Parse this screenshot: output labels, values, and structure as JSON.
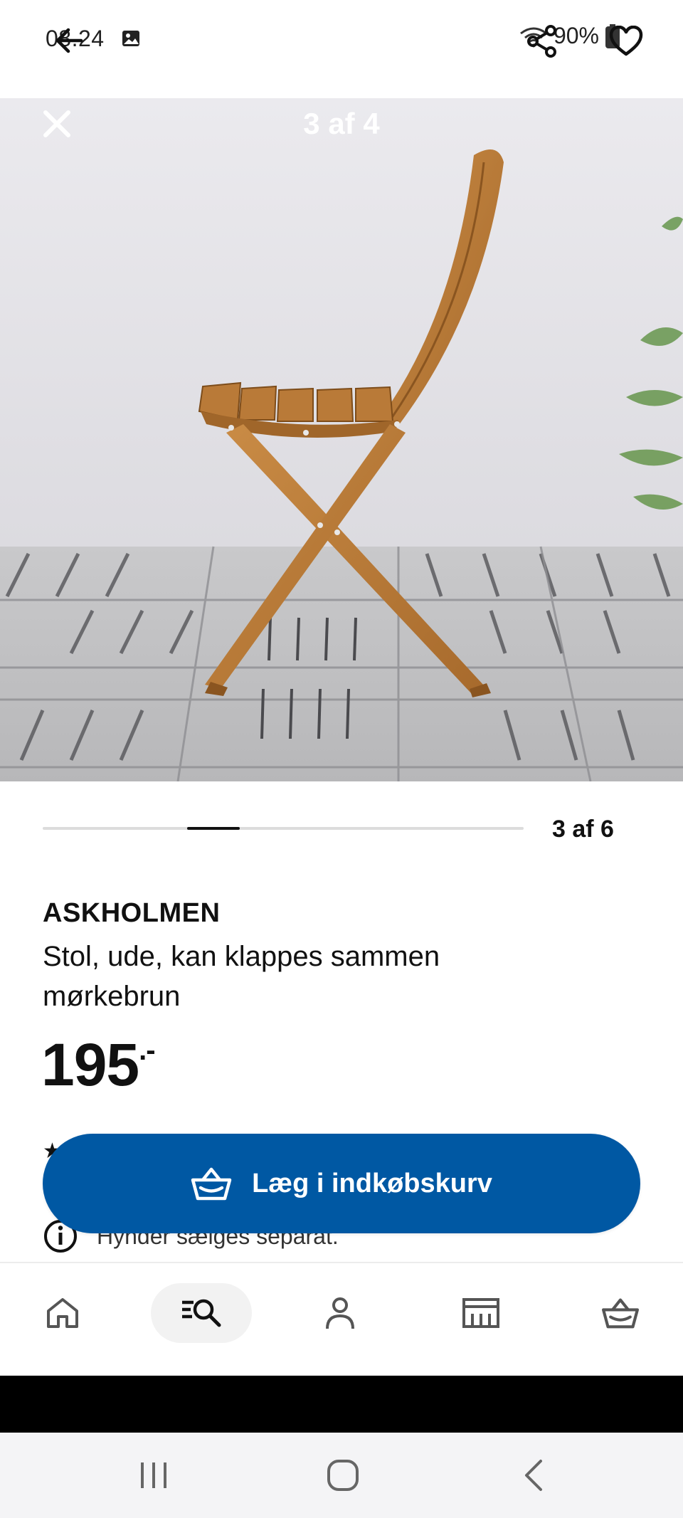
{
  "status_bar": {
    "time": "08.24",
    "battery": "90%",
    "icons": [
      "gallery-icon",
      "wifi-icon",
      "battery-icon"
    ]
  },
  "overlay": {
    "icons": [
      "back-arrow-icon",
      "share-icon",
      "heart-icon"
    ]
  },
  "gallery": {
    "counter": "3 af 4",
    "icons": [
      "close-icon"
    ]
  },
  "carousel": {
    "label": "3 af 6",
    "position": 3,
    "total": 6
  },
  "product": {
    "name": "ASKHOLMEN",
    "description_line1": "Stol, ude, kan klappes sammen",
    "description_line2": "mørkebrun",
    "price": "195",
    "price_suffix": ".-",
    "info_text": "Hynder sælges separat.",
    "rating_peek": "★"
  },
  "cart_button": {
    "label": "Læg i indkøbskurv",
    "icon": "shopping-basket-icon",
    "color": "#0058a3"
  },
  "bottom_nav": {
    "items": [
      {
        "name": "home",
        "icon": "home-icon",
        "active": false
      },
      {
        "name": "search",
        "icon": "search-icon",
        "active": true
      },
      {
        "name": "profile",
        "icon": "person-icon",
        "active": false
      },
      {
        "name": "stores",
        "icon": "store-icon",
        "active": false
      },
      {
        "name": "cart",
        "icon": "basket-icon",
        "active": false
      }
    ]
  },
  "system_nav": {
    "icons": [
      "recent-apps-icon",
      "home-circle-icon",
      "back-chevron-icon"
    ]
  },
  "colors": {
    "accent": "#0058a3",
    "text": "#111111",
    "nav_active_bg": "#f2f2f2"
  }
}
